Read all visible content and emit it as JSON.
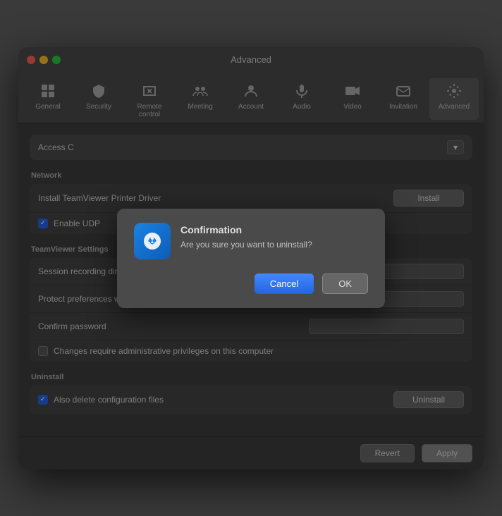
{
  "window": {
    "title": "Advanced"
  },
  "toolbar": {
    "items": [
      {
        "id": "general",
        "label": "General",
        "icon": "⊞"
      },
      {
        "id": "security",
        "label": "Security",
        "icon": "🛡"
      },
      {
        "id": "remote-control",
        "label": "Remote control",
        "icon": "🖱"
      },
      {
        "id": "meeting",
        "label": "Meeting",
        "icon": "👥"
      },
      {
        "id": "account",
        "label": "Account",
        "icon": "👤"
      },
      {
        "id": "audio",
        "label": "Audio",
        "icon": "🎵"
      },
      {
        "id": "video",
        "label": "Video",
        "icon": "🎥"
      },
      {
        "id": "invitation",
        "label": "Invitation",
        "icon": "✉"
      },
      {
        "id": "advanced",
        "label": "Advanced",
        "icon": "⚙"
      }
    ]
  },
  "sections": {
    "advanced": {
      "header": "Advanced",
      "access_label": "Access C"
    },
    "network": {
      "header": "Network",
      "install_driver_label": "Install TeamViewer Printer Driver",
      "install_btn_label": "Install",
      "enable_udp_label": "Enable UDP",
      "enable_udp_checked": true
    },
    "teamviewer_settings": {
      "header": "TeamViewer Settings",
      "session_recording_label": "Session recording directory",
      "protect_prefs_label": "Protect preferences with password",
      "confirm_password_label": "Confirm password",
      "admin_privileges_label": "Changes require administrative privileges on this computer",
      "admin_privileges_checked": false
    },
    "uninstall": {
      "header": "Uninstall",
      "delete_config_label": "Also delete configuration files",
      "delete_config_checked": true,
      "uninstall_btn_label": "Uninstall"
    }
  },
  "footer": {
    "revert_label": "Revert",
    "apply_label": "Apply"
  },
  "modal": {
    "title": "Confirmation",
    "message": "Are you sure you want to uninstall?",
    "cancel_label": "Cancel",
    "ok_label": "OK"
  }
}
